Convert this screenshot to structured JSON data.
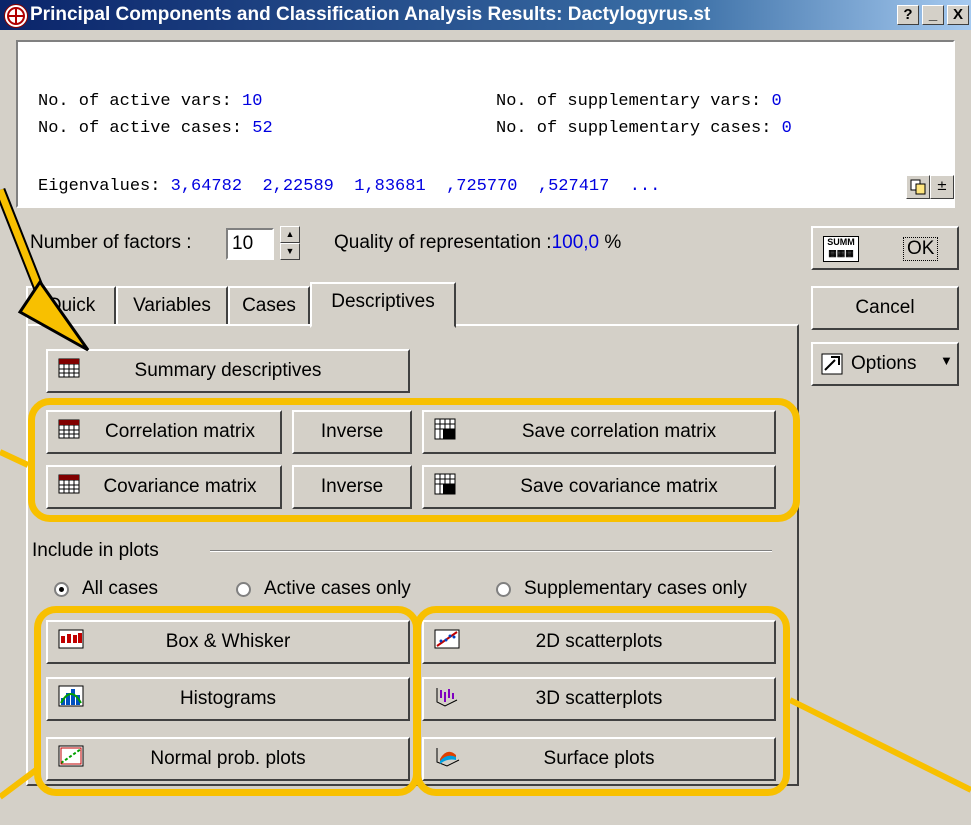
{
  "window": {
    "title": "Principal Components and Classification Analysis Results: Dactylogyrus.st",
    "help_btn": "?",
    "min_btn": "_",
    "close_btn": "X"
  },
  "results": {
    "active_vars_label": "No. of active vars:",
    "active_vars_value": "10",
    "supp_vars_label": "No. of supplementary vars:",
    "supp_vars_value": "0",
    "active_cases_label": "No. of active cases:",
    "active_cases_value": "52",
    "supp_cases_label": "No. of supplementary cases:",
    "supp_cases_value": "0",
    "eigenvalues_label": "Eigenvalues:",
    "eigenvalues_value": "3,64782  2,22589  1,83681  ,725770  ,527417  ..."
  },
  "factors": {
    "label": "Number of factors :",
    "value": "10",
    "quality_label": "Quality of representation :",
    "quality_value": "100,0",
    "quality_unit": "%"
  },
  "tabs": [
    "Quick",
    "Variables",
    "Cases",
    "Descriptives"
  ],
  "side_buttons": {
    "summary": "SUMM",
    "ok": "OK",
    "cancel": "Cancel",
    "options": "Options"
  },
  "descriptives": {
    "summary": "Summary descriptives",
    "correlation": "Correlation matrix",
    "inverse1": "Inverse",
    "save_correlation": "Save correlation matrix",
    "covariance": "Covariance matrix",
    "inverse2": "Inverse",
    "save_covariance": "Save covariance matrix"
  },
  "plots": {
    "group_label": "Include in plots",
    "radio_all": "All cases",
    "radio_active": "Active cases only",
    "radio_supp": "Supplementary cases only",
    "selected": "All cases",
    "box_whisker": "Box & Whisker",
    "histograms": "Histograms",
    "normal_prob": "Normal prob. plots",
    "scatter2d": "2D scatterplots",
    "scatter3d": "3D scatterplots",
    "surface": "Surface plots"
  },
  "colors": {
    "highlight": "#f8c000",
    "value_text": "#0000e0",
    "title_bar": "#0a246a"
  }
}
